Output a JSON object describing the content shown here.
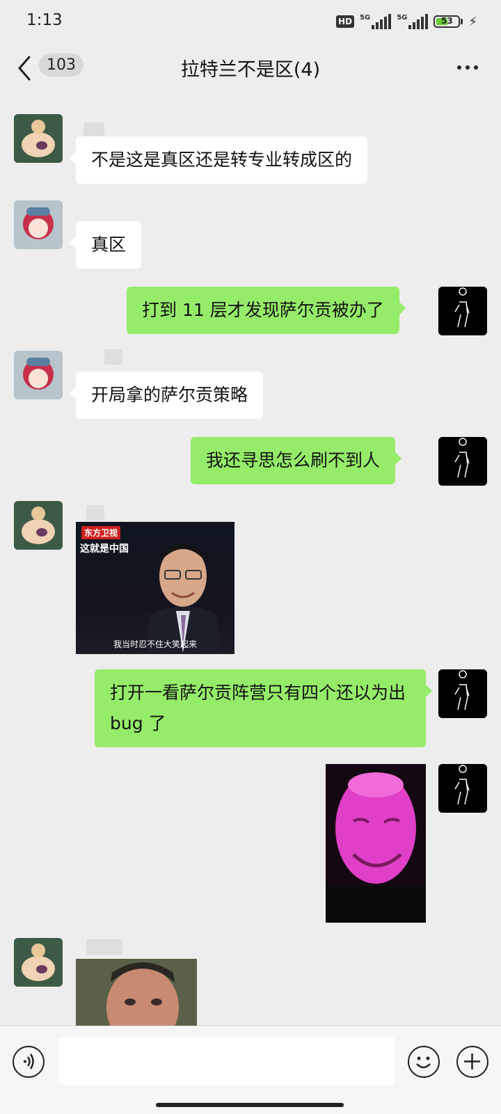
{
  "status_bar": {
    "time": "1:13",
    "hd_label": "HD",
    "network1": "5G",
    "network2": "5G",
    "battery": "53",
    "battery_level": 0.53,
    "battery_color": "#66cc33"
  },
  "header": {
    "back_badge": "103",
    "title": "拉特兰不是区(4)",
    "back_icon": "chevron-left-icon",
    "more_icon": "more-dots-icon"
  },
  "messages": [
    {
      "sender": "other",
      "avatar": "bear-avatar",
      "text": "不是这是真区还是转专业转成区的"
    },
    {
      "sender": "other",
      "avatar": "red-hair-girl-avatar",
      "text": "真区"
    },
    {
      "sender": "me",
      "avatar": "silhouette-avatar",
      "text": "打到 11 层才发现萨尔贡被办了"
    },
    {
      "sender": "other",
      "avatar": "red-hair-girl-avatar",
      "text": "开局拿的萨尔贡策略"
    },
    {
      "sender": "me",
      "avatar": "silhouette-avatar",
      "text": "我还寻思怎么刷不到人"
    },
    {
      "sender": "other",
      "avatar": "bear-avatar",
      "image": {
        "logo": "东方卫视",
        "show": "这就是中国",
        "caption": "我当时忍不住大笑起来"
      }
    },
    {
      "sender": "me",
      "avatar": "silhouette-avatar",
      "text": "打开一看萨尔贡阵营只有四个还以为出 bug 了"
    },
    {
      "sender": "me",
      "avatar": "silhouette-avatar",
      "image": {
        "desc_icon": "pink-face-sticker"
      }
    },
    {
      "sender": "other",
      "avatar": "bear-avatar",
      "image": {
        "desc_icon": "blurred-face-sticker"
      }
    }
  ],
  "colors": {
    "background": "#ededed",
    "outgoing_bubble": "#95ec69",
    "incoming_bubble": "#ffffff"
  },
  "input_bar": {
    "voice_icon": "voice-icon",
    "emoji_icon": "emoji-icon",
    "plus_icon": "plus-icon",
    "text_value": ""
  }
}
